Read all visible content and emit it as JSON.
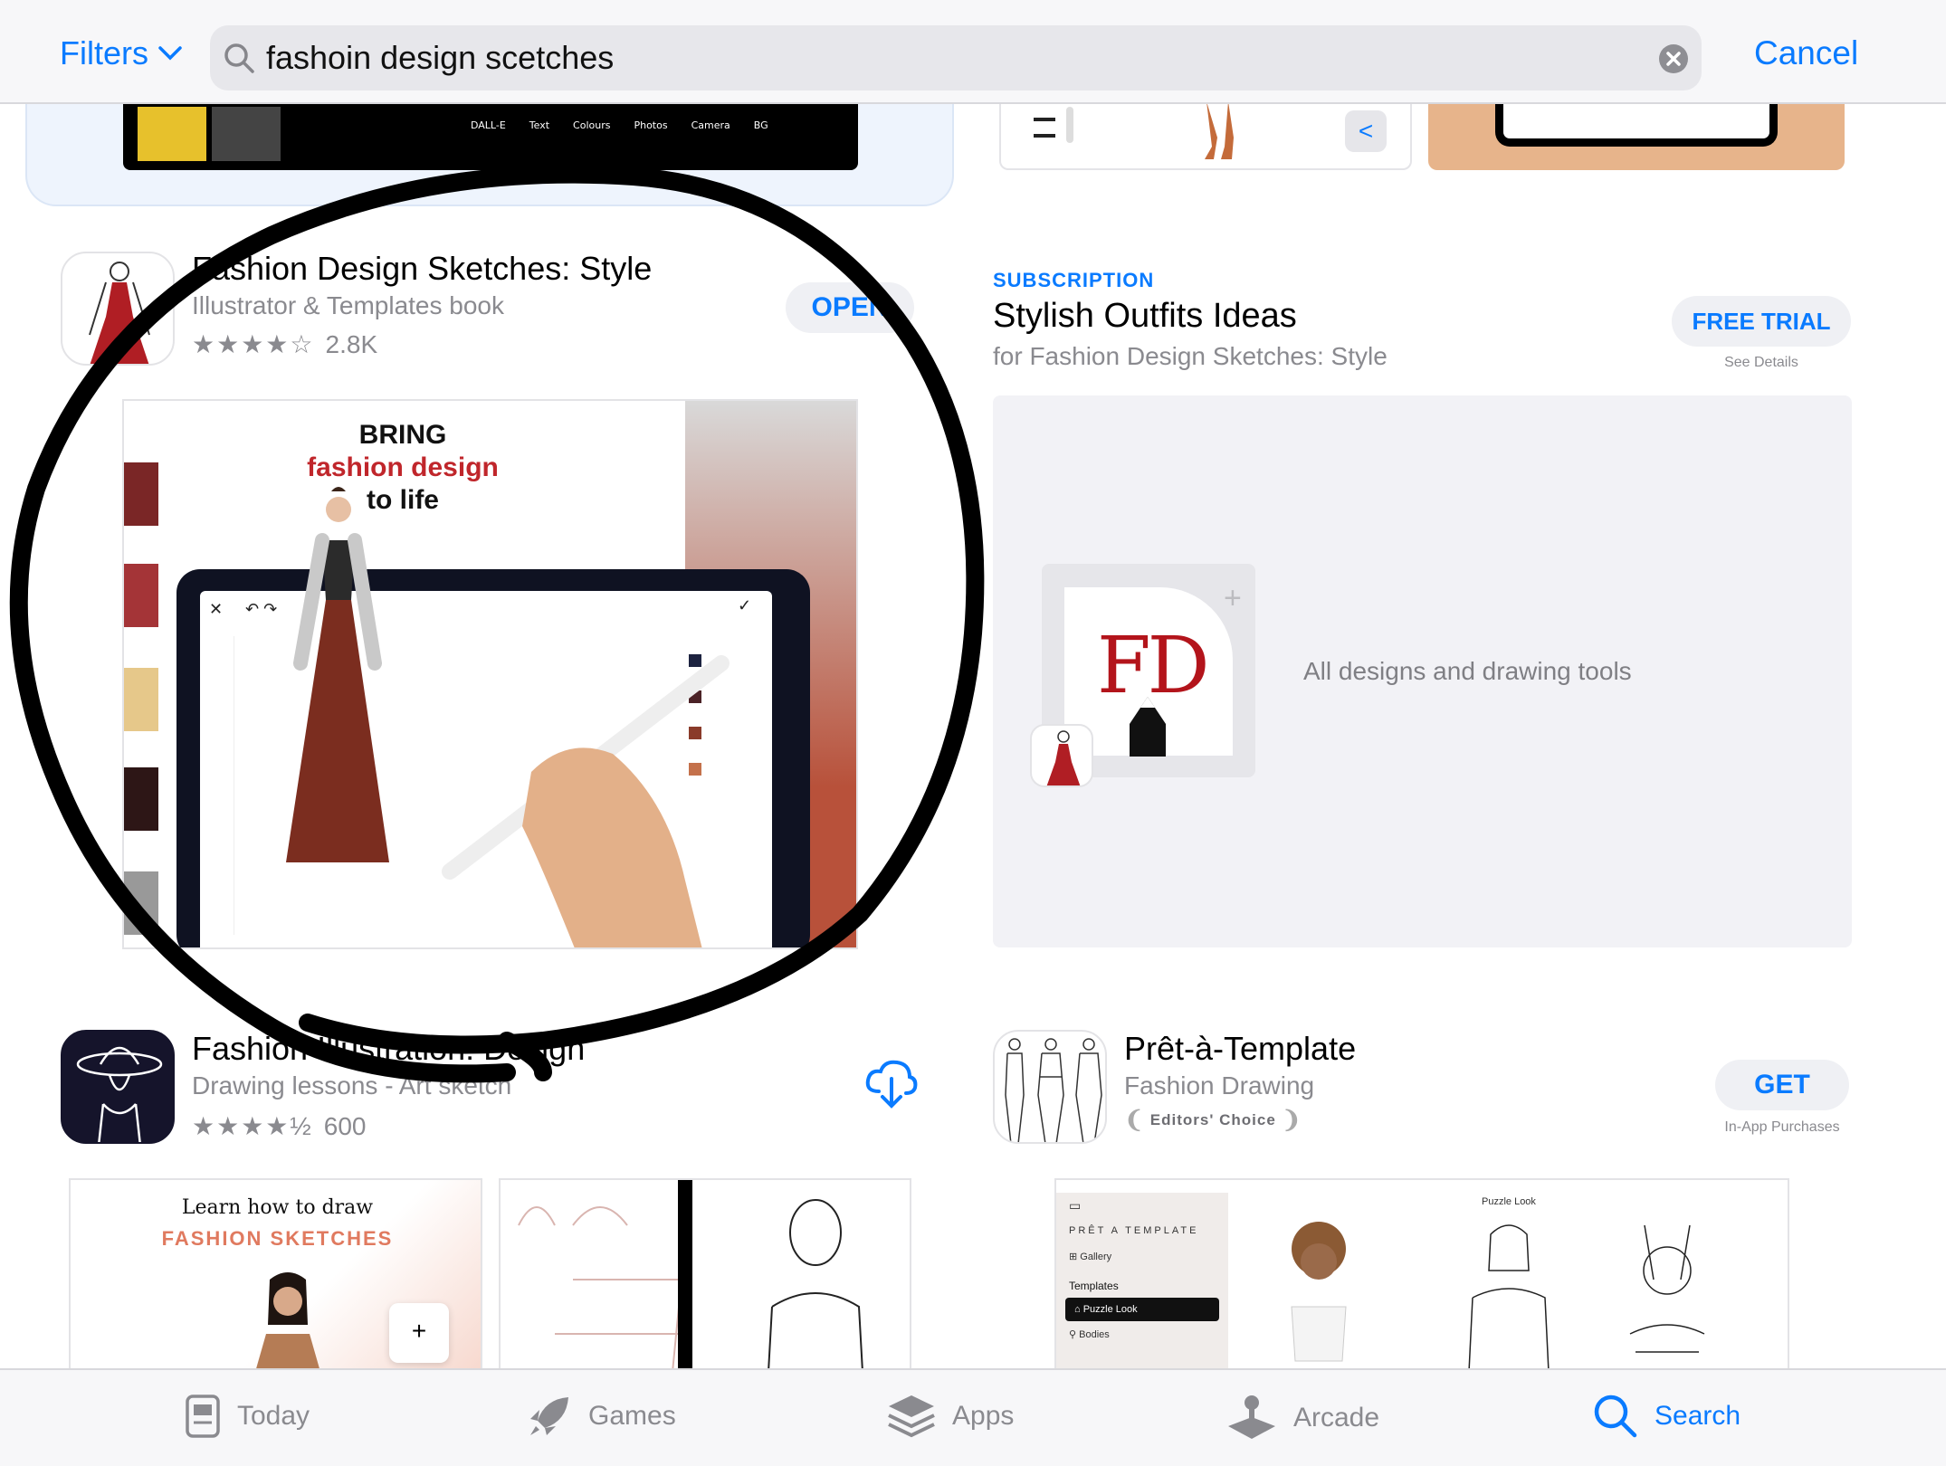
{
  "search": {
    "filters_label": "Filters",
    "query": "fashoin design scetches",
    "cancel_label": "Cancel"
  },
  "app1": {
    "title": "Fashion Design Sketches: Style",
    "subtitle": "Illustrator & Templates book",
    "stars": "★★★★☆",
    "ratings": "2.8K",
    "action": "OPEN",
    "screenshot": {
      "headline_1": "BRING",
      "headline_2": "fashion design",
      "headline_3": "to life"
    }
  },
  "subscription": {
    "tag": "SUBSCRIPTION",
    "title": "Stylish Outfits Ideas",
    "subtitle": "for Fashion Design Sketches: Style",
    "action": "FREE TRIAL",
    "details": "See Details",
    "icon_text": "FD",
    "description": "All designs and drawing tools"
  },
  "app2": {
    "title": "Fashion Illustration: Design",
    "subtitle": "Drawing lessons - Art sketch",
    "stars": "★★★★½",
    "ratings": "600",
    "screenshot": {
      "line1": "Learn how to draw",
      "line2": "FASHION SKETCHES"
    }
  },
  "app3": {
    "title": "Prêt-à-Template",
    "subtitle": "Fashion Drawing",
    "badge": "Editors' Choice",
    "action": "GET",
    "note": "In-App Purchases",
    "screenshot": {
      "brand": "PRÊT A TEMPLATE",
      "gallery": "Gallery",
      "templates": "Templates",
      "puzzle": "Puzzle Look",
      "bodies": "Bodies",
      "panel_title": "Puzzle Look"
    }
  },
  "toolbar_items": [
    "DALL-E",
    "Text",
    "Colours",
    "Photos",
    "Camera",
    "BG"
  ],
  "tabs": [
    {
      "label": "Today",
      "icon": "today-icon"
    },
    {
      "label": "Games",
      "icon": "rocket-icon"
    },
    {
      "label": "Apps",
      "icon": "layers-icon"
    },
    {
      "label": "Arcade",
      "icon": "joystick-icon"
    },
    {
      "label": "Search",
      "icon": "search-icon"
    }
  ],
  "colors": {
    "accent": "#0a7bff",
    "annotation": "#000000",
    "brand_red": "#b3141b"
  }
}
